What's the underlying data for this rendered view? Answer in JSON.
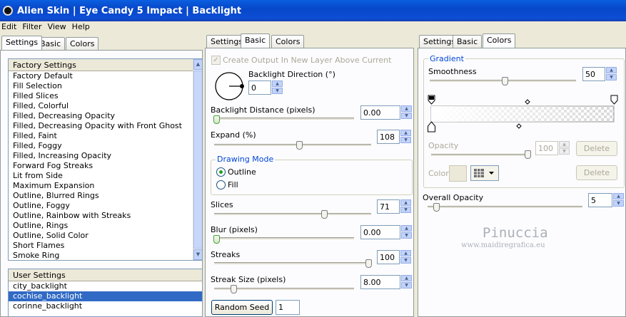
{
  "window": {
    "title": "Alien Skin  |  Eye Candy 5 Impact  |  Backlight"
  },
  "menu": [
    "Edit",
    "Filter",
    "View",
    "Help"
  ],
  "left_tabs": [
    "Settings",
    "Basic",
    "Colors"
  ],
  "factory": {
    "header": "Factory Settings",
    "items": [
      "Factory Default",
      "Fill Selection",
      "Filled Slices",
      "Filled, Colorful",
      "Filled, Decreasing Opacity",
      "Filled, Decreasing Opacity with Front Ghost",
      "Filled, Faint",
      "Filled, Foggy",
      "Filled, Increasing Opacity",
      "Forward Fog Streaks",
      "Lit from Side",
      "Maximum Expansion",
      "Outline, Blurred Rings",
      "Outline, Foggy",
      "Outline, Rainbow with Streaks",
      "Outline, Rings",
      "Outline, Solid Color",
      "Short Flames",
      "Smoke Ring"
    ]
  },
  "user": {
    "header": "User Settings",
    "items": [
      "city_backlight",
      "cochise_backlight",
      "corinne_backlight"
    ],
    "selected": 1
  },
  "mid_tabs": [
    "Settings",
    "Basic",
    "Colors"
  ],
  "basic": {
    "create_output": "Create Output In New Layer Above Current",
    "direction_label": "Backlight Direction (°)",
    "direction_value": "0",
    "distance_label": "Backlight Distance (pixels)",
    "distance_value": "0.00",
    "expand_label": "Expand (%)",
    "expand_value": "108",
    "drawing_mode": "Drawing Mode",
    "outline": "Outline",
    "fill": "Fill",
    "slices_label": "Slices",
    "slices_value": "71",
    "blur_label": "Blur (pixels)",
    "blur_value": "0.00",
    "streaks_label": "Streaks",
    "streaks_value": "100",
    "streak_size_label": "Streak Size (pixels)",
    "streak_size_value": "8.00",
    "random_seed": "Random Seed",
    "seed_value": "1"
  },
  "right_tabs": [
    "Settings",
    "Basic",
    "Colors"
  ],
  "colors": {
    "gradient": "Gradient",
    "smoothness_label": "Smoothness",
    "smoothness_value": "50",
    "opacity_label": "Opacity",
    "opacity_value": "100",
    "delete": "Delete",
    "color_label": "Color",
    "overall_label": "Overall Opacity",
    "overall_value": "5"
  },
  "watermark": {
    "name": "Pinuccia",
    "url": "www.maidiregrafica.eu"
  }
}
